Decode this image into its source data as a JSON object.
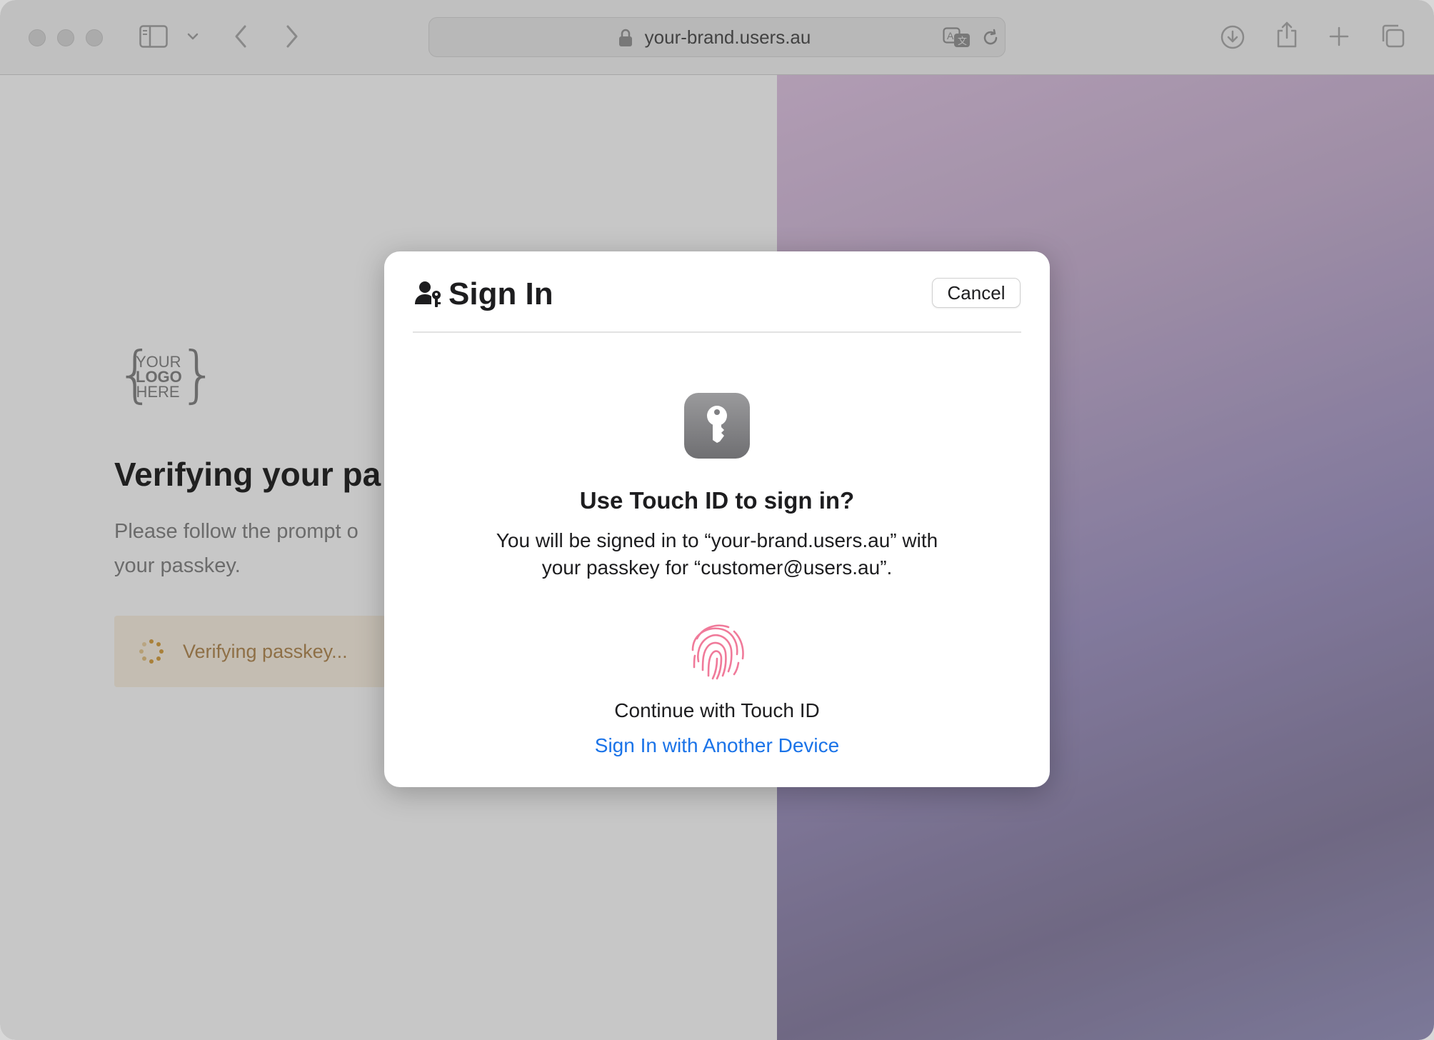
{
  "browser": {
    "url": "your-brand.users.au"
  },
  "page": {
    "logo_text": [
      "YOUR",
      "LOGO",
      "HERE"
    ],
    "heading": "Verifying your pa",
    "subtext_line1": "Please follow the prompt o",
    "subtext_line2": "your passkey.",
    "verifying_status": "Verifying passkey..."
  },
  "dialog": {
    "title": "Sign In",
    "cancel_label": "Cancel",
    "question": "Use Touch ID to sign in?",
    "body_line1": "You will be signed in to “your-brand.users.au” with",
    "body_line2": "your passkey for “customer@users.au”.",
    "touch_id_label": "Continue with Touch ID",
    "another_device_label": "Sign In with Another Device"
  },
  "colors": {
    "link": "#1a73e8",
    "status_text": "#b68f5a",
    "fingerprint": "#f07a9a"
  },
  "icons": [
    "sidebar-icon",
    "chevron-down-icon",
    "back-icon",
    "forward-icon",
    "lock-icon",
    "translate-icon",
    "reload-icon",
    "download-icon",
    "share-icon",
    "plus-icon",
    "tabs-icon",
    "person-key-icon",
    "key-icon",
    "fingerprint-icon",
    "spinner-icon"
  ]
}
